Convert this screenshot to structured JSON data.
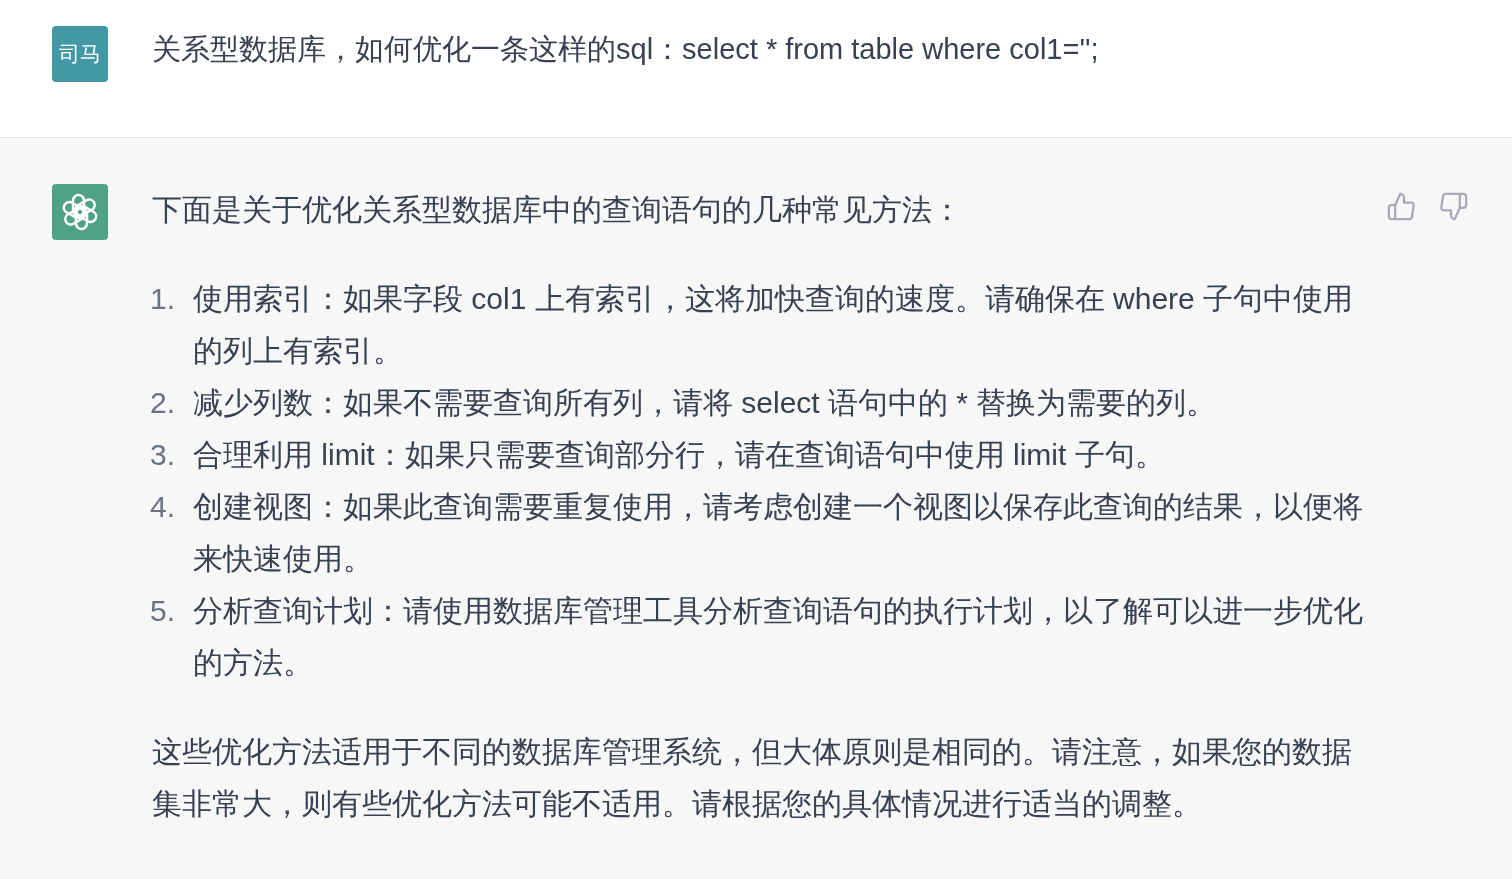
{
  "messages": [
    {
      "kind": "user",
      "avatar": "司马",
      "text": "关系型数据库，如何优化一条这样的sql：select * from table where col1='';"
    },
    {
      "kind": "assistant",
      "intro": "下面是关于优化关系型数据库中的查询语句的几种常见方法：",
      "list": [
        {
          "number": "1.",
          "text": "使用索引：如果字段 col1 上有索引，这将加快查询的速度。请确保在 where 子句中使用的列上有索引。"
        },
        {
          "number": "2.",
          "text": "减少列数：如果不需要查询所有列，请将 select 语句中的 * 替换为需要的列。"
        },
        {
          "number": "3.",
          "text": "合理利用 limit：如果只需要查询部分行，请在查询语句中使用 limit 子句。"
        },
        {
          "number": "4.",
          "text": "创建视图：如果此查询需要重复使用，请考虑创建一个视图以保存此查询的结果，以便将来快速使用。"
        },
        {
          "number": "5.",
          "text": "分析查询计划：请使用数据库管理工具分析查询语句的执行计划，以了解可以进一步优化的方法。"
        }
      ],
      "closing": "这些优化方法适用于不同的数据库管理系统，但大体原则是相同的。请注意，如果您的数据集非常大，则有些优化方法可能不适用。请根据您的具体情况进行适当的调整。"
    }
  ]
}
